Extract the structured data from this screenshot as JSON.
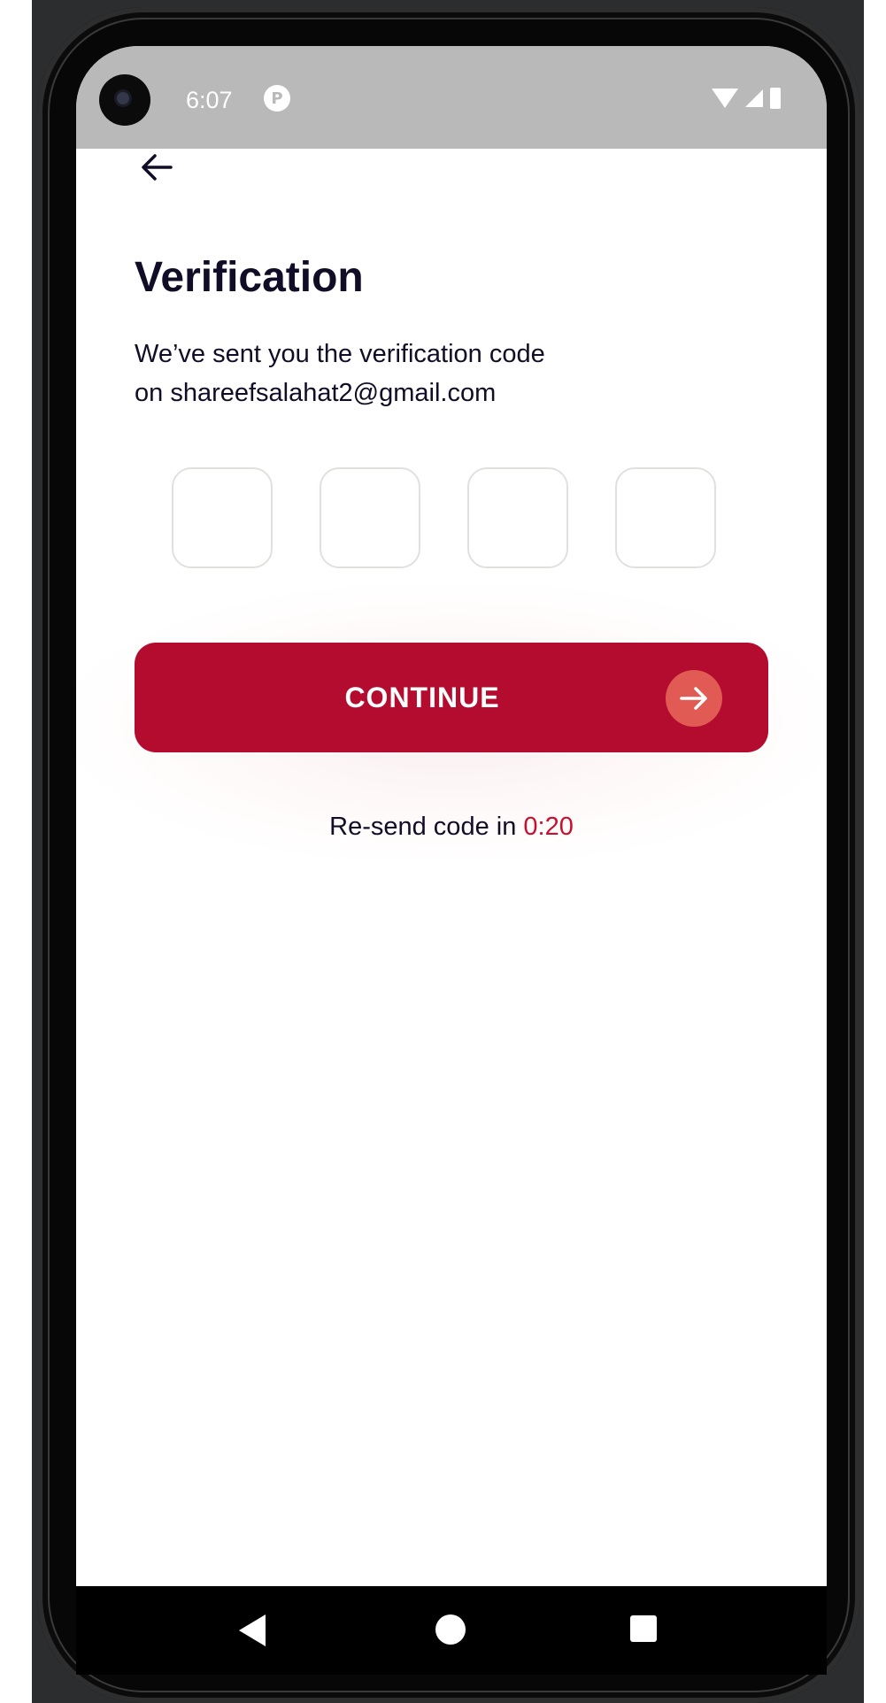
{
  "status_bar": {
    "time": "6:07",
    "notification_icon": "p-circle-icon",
    "icons": [
      "wifi-icon",
      "signal-icon",
      "battery-icon"
    ]
  },
  "header": {
    "back_icon": "arrow-left-icon"
  },
  "verification": {
    "title": "Verification",
    "subtitle_line1": "We’ve sent you the verification code",
    "subtitle_line2": "on shareefsalahat2@gmail.com",
    "code_digits": [
      "",
      "",
      "",
      ""
    ]
  },
  "continue_button": {
    "label": "CONTINUE",
    "icon": "arrow-right-icon"
  },
  "resend": {
    "prefix": "Re-send code in ",
    "timer": "0:20"
  },
  "colors": {
    "primary": "#b30c2f",
    "accent_circle": "#e15b54",
    "timer_text": "#c8102e",
    "text_dark": "#120d26"
  },
  "navigation_bar": {
    "buttons": [
      "back-triangle-icon",
      "home-circle-icon",
      "recents-square-icon"
    ]
  }
}
